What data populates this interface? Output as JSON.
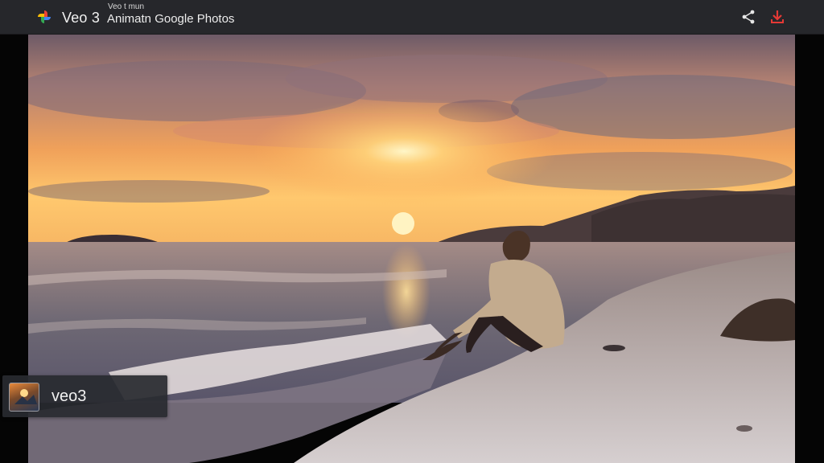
{
  "header": {
    "brand": "Veo 3",
    "subtitle_small": "Veo t mun",
    "subtitle_main": "Animatn Google Photos",
    "logo_icon": "google-photos-pinwheel-icon",
    "share_icon": "share-icon",
    "download_icon": "download-icon",
    "accent_download": "#e53935"
  },
  "badge": {
    "label": "veo3",
    "thumbnail_icon": "photo-thumbnail-icon"
  },
  "colors": {
    "topbar": "#26272b",
    "background": "#050505"
  }
}
